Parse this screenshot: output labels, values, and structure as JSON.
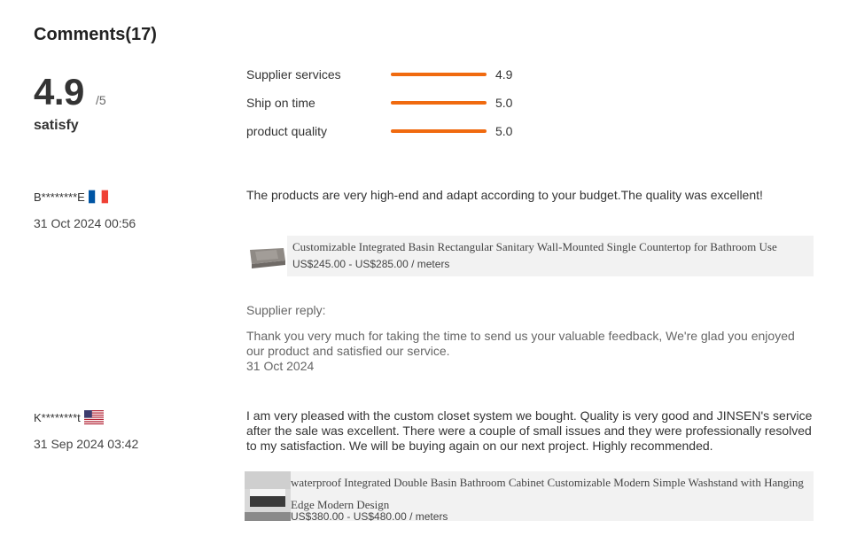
{
  "header": {
    "title": "Comments(17)"
  },
  "summary": {
    "score": "4.9",
    "out_of": "/5",
    "label": "satisfy"
  },
  "ratings": [
    {
      "label": "Supplier services",
      "value": "4.9",
      "fraction": 0.98
    },
    {
      "label": "Ship on time",
      "value": "5.0",
      "fraction": 1.0
    },
    {
      "label": "product quality",
      "value": "5.0",
      "fraction": 1.0
    }
  ],
  "reviews": [
    {
      "user": "B********E",
      "country": "France",
      "date": "31 Oct 2024 00:56",
      "text": "The products are very high-end and adapt according to your budget.The quality was excellent!",
      "product": {
        "title": "Customizable Integrated Basin Rectangular Sanitary Wall-Mounted Single Countertop for Bathroom Use",
        "price": "US$245.00 - US$285.00 / meters"
      },
      "reply_heading": "Supplier reply:",
      "reply_text": "Thank you very much for taking the time to send us your valuable feedback, We're glad you enjoyed our product and satisfied our service.",
      "reply_date": "31 Oct 2024"
    },
    {
      "user": "K********t",
      "country": "United States",
      "date": "31 Sep 2024 03:42",
      "text": "I am very pleased with the custom closet system we bought. Quality is very good and JINSEN's service after the sale was excellent. There were a couple of small issues and they were professionally resolved to my satisfaction. We will be buying again on our next project. Highly recommended.",
      "product": {
        "title": "waterproof Integrated Double Basin Bathroom Cabinet Customizable Modern Simple Washstand with Hanging Edge Modern Design",
        "price": "US$380.00 - US$480.00 / meters"
      }
    }
  ],
  "colors": {
    "accent": "#f06a0f",
    "card_bg": "#f2f2f2"
  }
}
